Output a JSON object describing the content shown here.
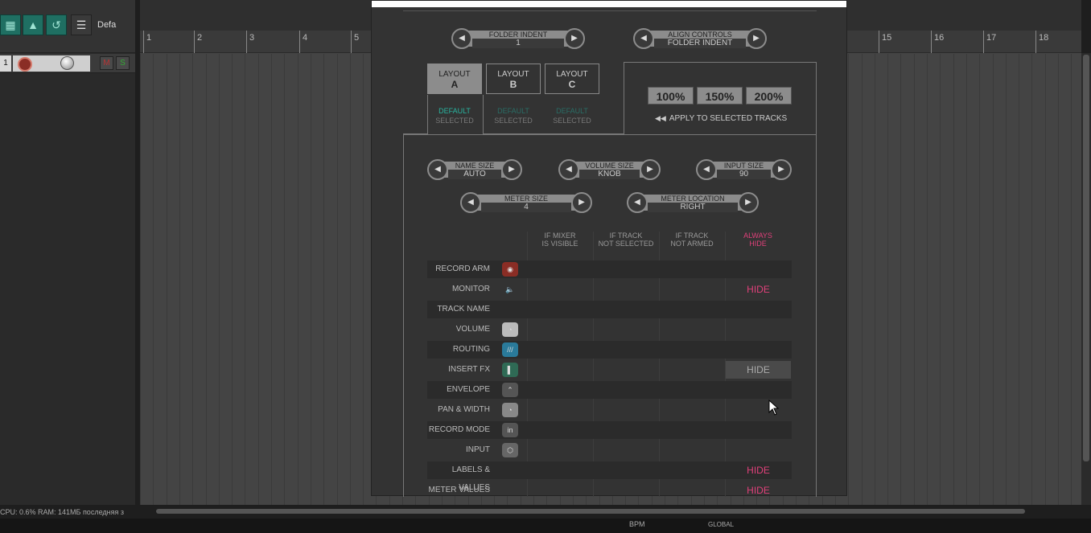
{
  "toolbar": {
    "track_template_label": "Defa"
  },
  "track": {
    "number": "1",
    "mute_label": "M",
    "solo_label": "S"
  },
  "status_bar": "CPU: 0.6% RAM: 141МБ последняя з",
  "ruler": {
    "marks": [
      "1",
      "2",
      "3",
      "4",
      "5",
      "15",
      "16",
      "17",
      "18"
    ]
  },
  "dialog": {
    "folder_indent": {
      "label": "FOLDER INDENT",
      "value": "1"
    },
    "align_controls": {
      "label": "ALIGN CONTROLS",
      "value": "FOLDER INDENT"
    },
    "layouts": [
      {
        "line1": "LAYOUT",
        "line2": "A",
        "default": "DEFAULT",
        "selected": "SELECTED"
      },
      {
        "line1": "LAYOUT",
        "line2": "B",
        "default": "DEFAULT",
        "selected": "SELECTED"
      },
      {
        "line1": "LAYOUT",
        "line2": "C",
        "default": "DEFAULT",
        "selected": "SELECTED"
      }
    ],
    "scales": [
      "100%",
      "150%",
      "200%"
    ],
    "apply_label": "APPLY TO SELECTED TRACKS",
    "name_size": {
      "label": "NAME SIZE",
      "value": "AUTO"
    },
    "volume_size": {
      "label": "VOLUME SIZE",
      "value": "KNOB"
    },
    "input_size": {
      "label": "INPUT SIZE",
      "value": "90"
    },
    "meter_size": {
      "label": "METER SIZE",
      "value": "4"
    },
    "meter_location": {
      "label": "METER LOCATION",
      "value": "RIGHT"
    },
    "columns": [
      {
        "line1": "IF MIXER",
        "line2": "IS VISIBLE"
      },
      {
        "line1": "IF TRACK",
        "line2": "NOT SELECTED"
      },
      {
        "line1": "IF TRACK",
        "line2": "NOT ARMED"
      },
      {
        "line1": "ALWAYS",
        "line2": "HIDE"
      }
    ],
    "rows": [
      {
        "label": "RECORD ARM",
        "icon": "record-arm-icon",
        "hide": ""
      },
      {
        "label": "MONITOR",
        "icon": "speaker-icon",
        "hide": "HIDE"
      },
      {
        "label": "TRACK NAME",
        "icon": "",
        "hide": ""
      },
      {
        "label": "VOLUME",
        "icon": "volume-knob-icon",
        "hide": ""
      },
      {
        "label": "ROUTING",
        "icon": "routing-icon",
        "hide": ""
      },
      {
        "label": "INSERT FX",
        "icon": "fx-icon",
        "hide": "HIDE"
      },
      {
        "label": "ENVELOPE",
        "icon": "envelope-icon",
        "hide": ""
      },
      {
        "label": "PAN & WIDTH",
        "icon": "pan-knob-icon",
        "hide": ""
      },
      {
        "label": "RECORD MODE",
        "icon": "record-mode-icon",
        "hide": ""
      },
      {
        "label": "INPUT",
        "icon": "input-icon",
        "hide": ""
      },
      {
        "label": "LABELS & VALUES",
        "icon": "",
        "hide": "HIDE"
      },
      {
        "label": "METER VALUES",
        "icon": "",
        "hide": "HIDE"
      }
    ],
    "record_mode_icon_text": "in"
  },
  "transport": {
    "bpm_label": "BPM",
    "global_label": "GLOBAL"
  },
  "colors": {
    "accent_teal": "#1f6f62",
    "hide_pink": "#e0407a",
    "default_selected_teal": "#29b5a0"
  }
}
